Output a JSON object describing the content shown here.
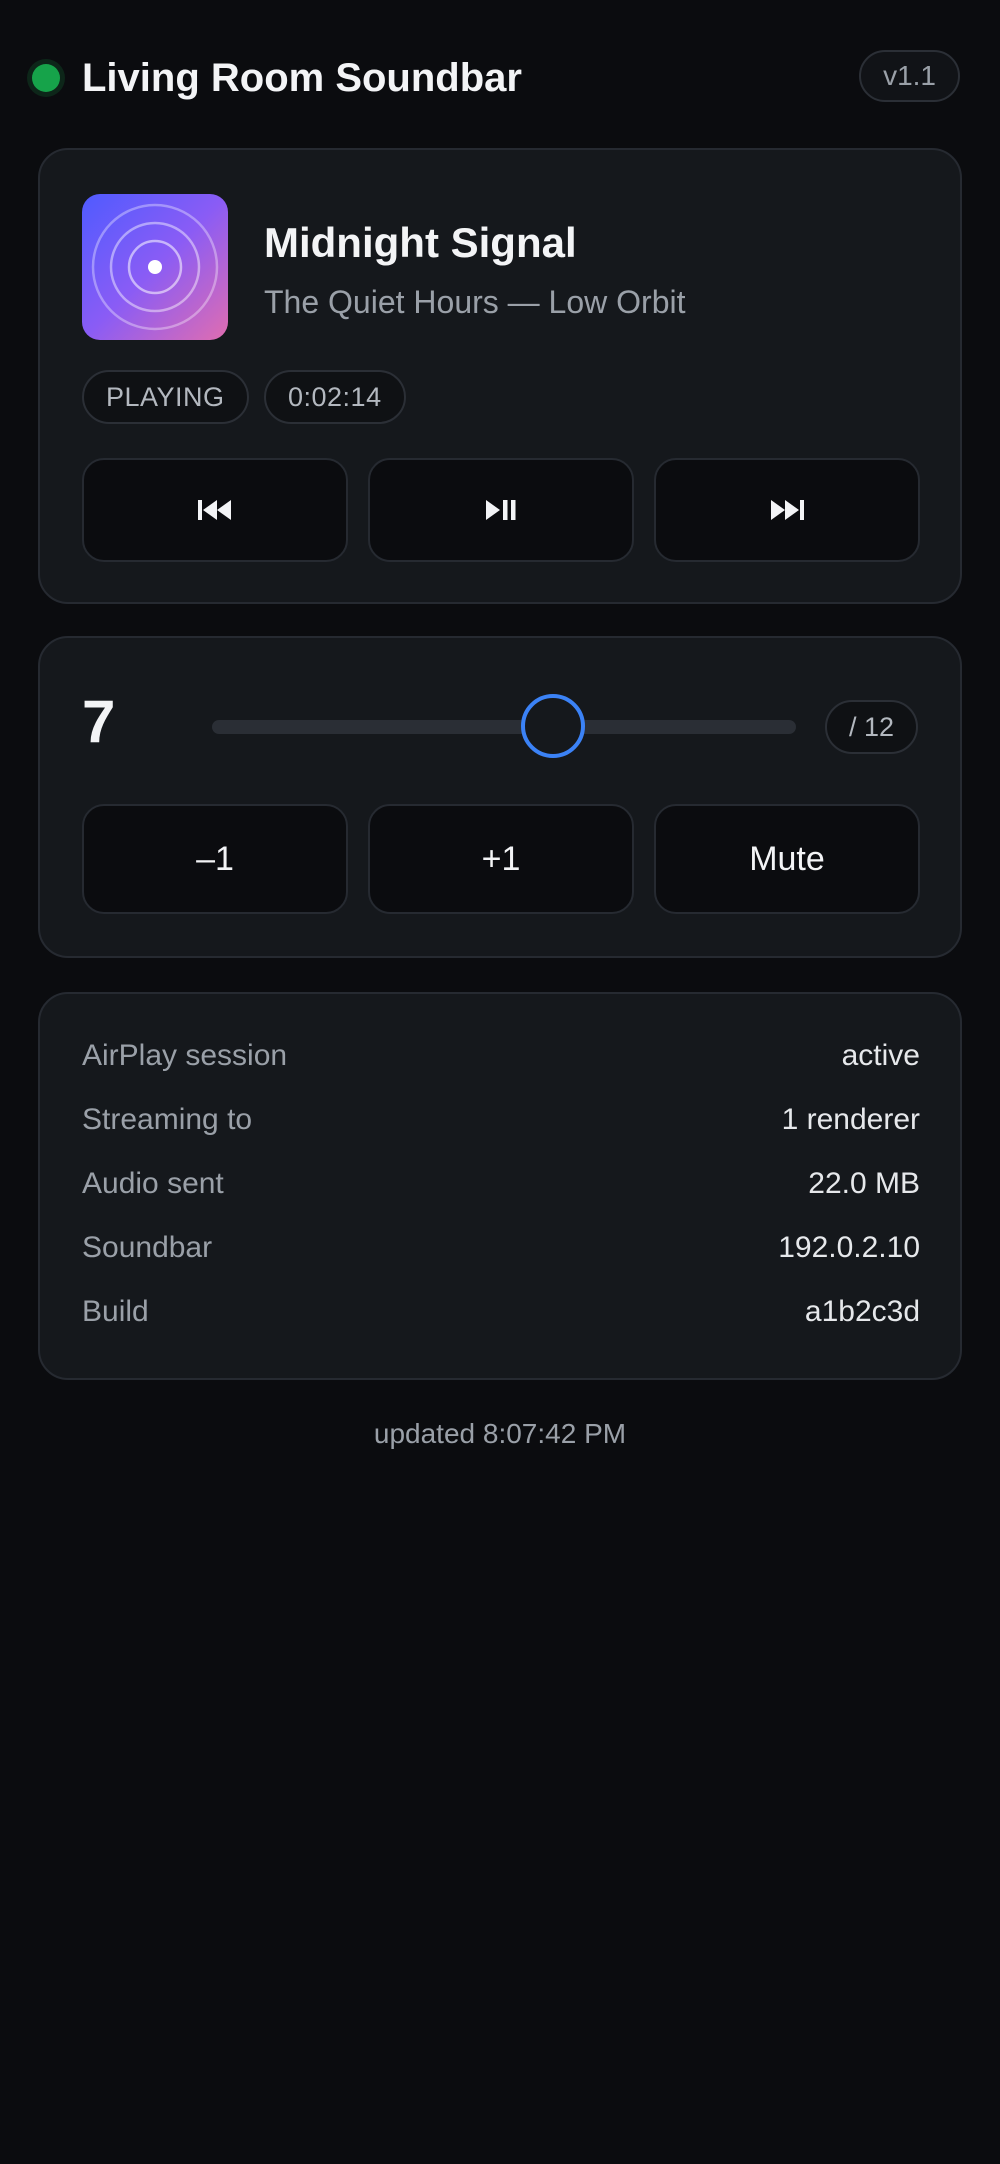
{
  "header": {
    "title": "Living Room Soundbar",
    "version": "v1.1",
    "status_color": "#16a34a"
  },
  "now_playing": {
    "album_art_icon": "concentric-rings-icon",
    "title": "Midnight Signal",
    "subtitle": "The Quiet Hours — Low Orbit",
    "state": "PLAYING",
    "elapsed": "0:02:14",
    "controls": {
      "previous_icon": "skip-previous-icon",
      "play_pause_icon": "play-pause-icon",
      "next_icon": "skip-next-icon"
    }
  },
  "volume": {
    "value": "7",
    "max_label": "/ 12",
    "level": 7,
    "max": 12,
    "down_label": "–1",
    "up_label": "+1",
    "mute_label": "Mute",
    "accent": "#3b82f6"
  },
  "info": {
    "rows": [
      {
        "label": "AirPlay session",
        "value": "active"
      },
      {
        "label": "Streaming to",
        "value": "1 renderer"
      },
      {
        "label": "Audio sent",
        "value": "22.0 MB"
      },
      {
        "label": "Soundbar",
        "value": "192.0.2.10"
      },
      {
        "label": "Build",
        "value": "a1b2c3d"
      }
    ]
  },
  "footer": {
    "updated": "updated 8:07:42 PM"
  }
}
